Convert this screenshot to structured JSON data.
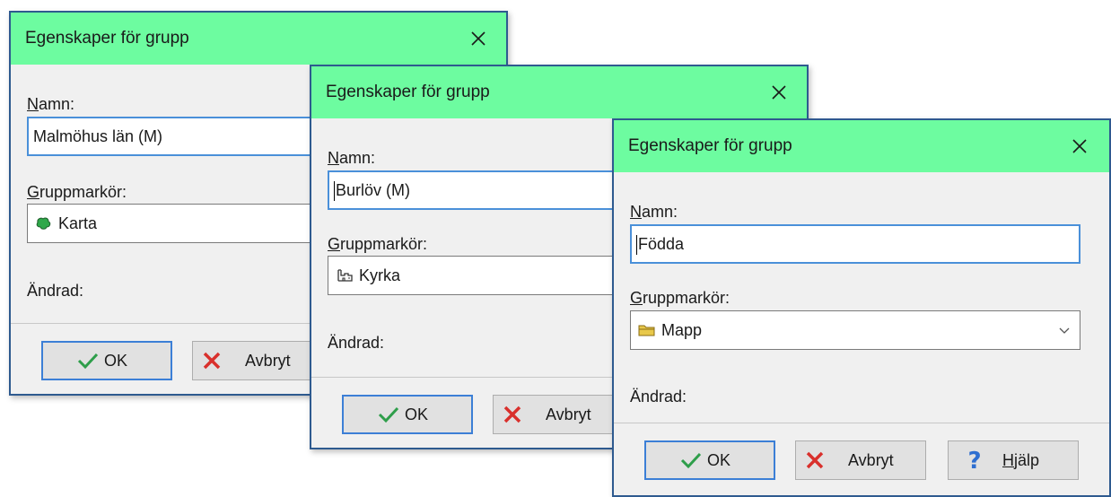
{
  "dialogs": [
    {
      "title": "Egenskaper för grupp",
      "name_label_u": "N",
      "name_label_rest": "amn:",
      "name_value": "Malmöhus län (M)",
      "marker_label_u": "G",
      "marker_label_rest": "ruppmarkör:",
      "marker_value": "Karta",
      "marker_icon": "map-icon",
      "changed_label": "Ändrad:",
      "ok_label": "OK",
      "cancel_label": "Avbryt"
    },
    {
      "title": "Egenskaper för grupp",
      "name_label_u": "N",
      "name_label_rest": "amn:",
      "name_value": "Burlöv (M)",
      "marker_label_u": "G",
      "marker_label_rest": "ruppmarkör:",
      "marker_value": "Kyrka",
      "marker_icon": "church-icon",
      "changed_label": "Ändrad:",
      "ok_label": "OK",
      "cancel_label": "Avbryt"
    },
    {
      "title": "Egenskaper för grupp",
      "name_label_u": "N",
      "name_label_rest": "amn:",
      "name_value": "Födda",
      "marker_label_u": "G",
      "marker_label_rest": "ruppmarkör:",
      "marker_value": "Mapp",
      "marker_icon": "folder-icon",
      "changed_label": "Ändrad:",
      "ok_label": "OK",
      "cancel_label": "Avbryt",
      "help_label_u": "H",
      "help_label_rest": "jälp"
    }
  ],
  "colors": {
    "titlebar": "#6dfca0",
    "dialog_border": "#2e5a8f",
    "focus_border": "#4a90d9",
    "ok_check": "#2e9e4a",
    "cancel_x": "#d9302c",
    "help_q": "#2f6fd0"
  }
}
